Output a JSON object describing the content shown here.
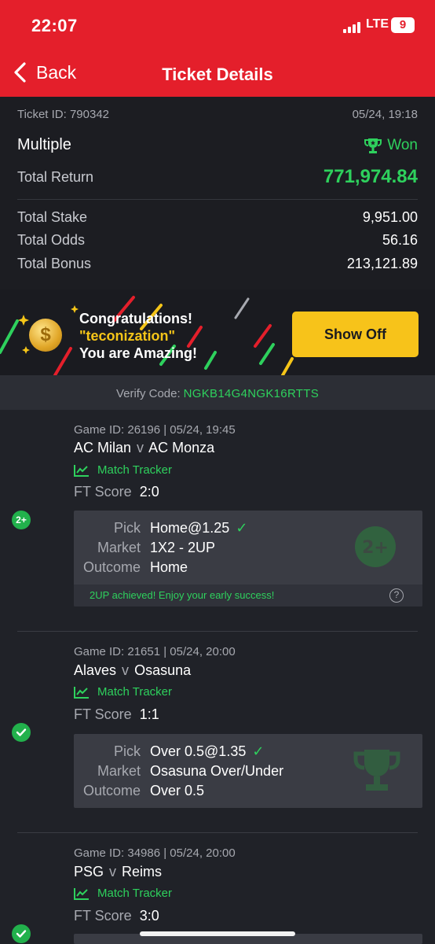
{
  "status_bar": {
    "time": "22:07",
    "network": "LTE",
    "battery": "9"
  },
  "nav": {
    "back_label": "Back",
    "title": "Ticket Details"
  },
  "summary": {
    "ticket_id": "Ticket ID: 790342",
    "date": "05/24, 19:18",
    "type": "Multiple",
    "status": "Won",
    "total_return_label": "Total Return",
    "total_return": "771,974.84",
    "stats": [
      {
        "label": "Total Stake",
        "value": "9,951.00"
      },
      {
        "label": "Total Odds",
        "value": "56.16"
      },
      {
        "label": "Total Bonus",
        "value": "213,121.89"
      }
    ]
  },
  "banner": {
    "line1": "Congratulations!",
    "user": "\"teconization\"",
    "line3": "You are Amazing!",
    "button": "Show Off"
  },
  "verify": {
    "label": "Verify Code:",
    "code": "NGKB14G4NGK16RTTS"
  },
  "bets": [
    {
      "meta": "Game ID: 26196 | 05/24, 19:45",
      "home": "AC Milan",
      "vs": "v",
      "away": "AC Monza",
      "tracker": "Match Tracker",
      "ft_label": "FT Score",
      "ft_score": "2:0",
      "pick_label": "Pick",
      "pick": "Home@1.25",
      "market_label": "Market",
      "market": "1X2 - 2UP",
      "outcome_label": "Outcome",
      "outcome": "Home",
      "note": "2UP achieved! Enjoy your early success!",
      "badge": "2+"
    },
    {
      "meta": "Game ID: 21651 | 05/24, 20:00",
      "home": "Alaves",
      "vs": "v",
      "away": "Osasuna",
      "tracker": "Match Tracker",
      "ft_label": "FT Score",
      "ft_score": "1:1",
      "pick_label": "Pick",
      "pick": "Over 0.5@1.35",
      "market_label": "Market",
      "market": "Osasuna Over/Under",
      "outcome_label": "Outcome",
      "outcome": "Over 0.5"
    },
    {
      "meta": "Game ID: 34986 | 05/24, 20:00",
      "home": "PSG",
      "vs": "v",
      "away": "Reims",
      "tracker": "Match Tracker",
      "ft_label": "FT Score",
      "ft_score": "3:0"
    }
  ],
  "colors": {
    "brand_red": "#e41f2b",
    "win_green": "#2ed15d",
    "accent_yellow": "#f7c31a"
  }
}
